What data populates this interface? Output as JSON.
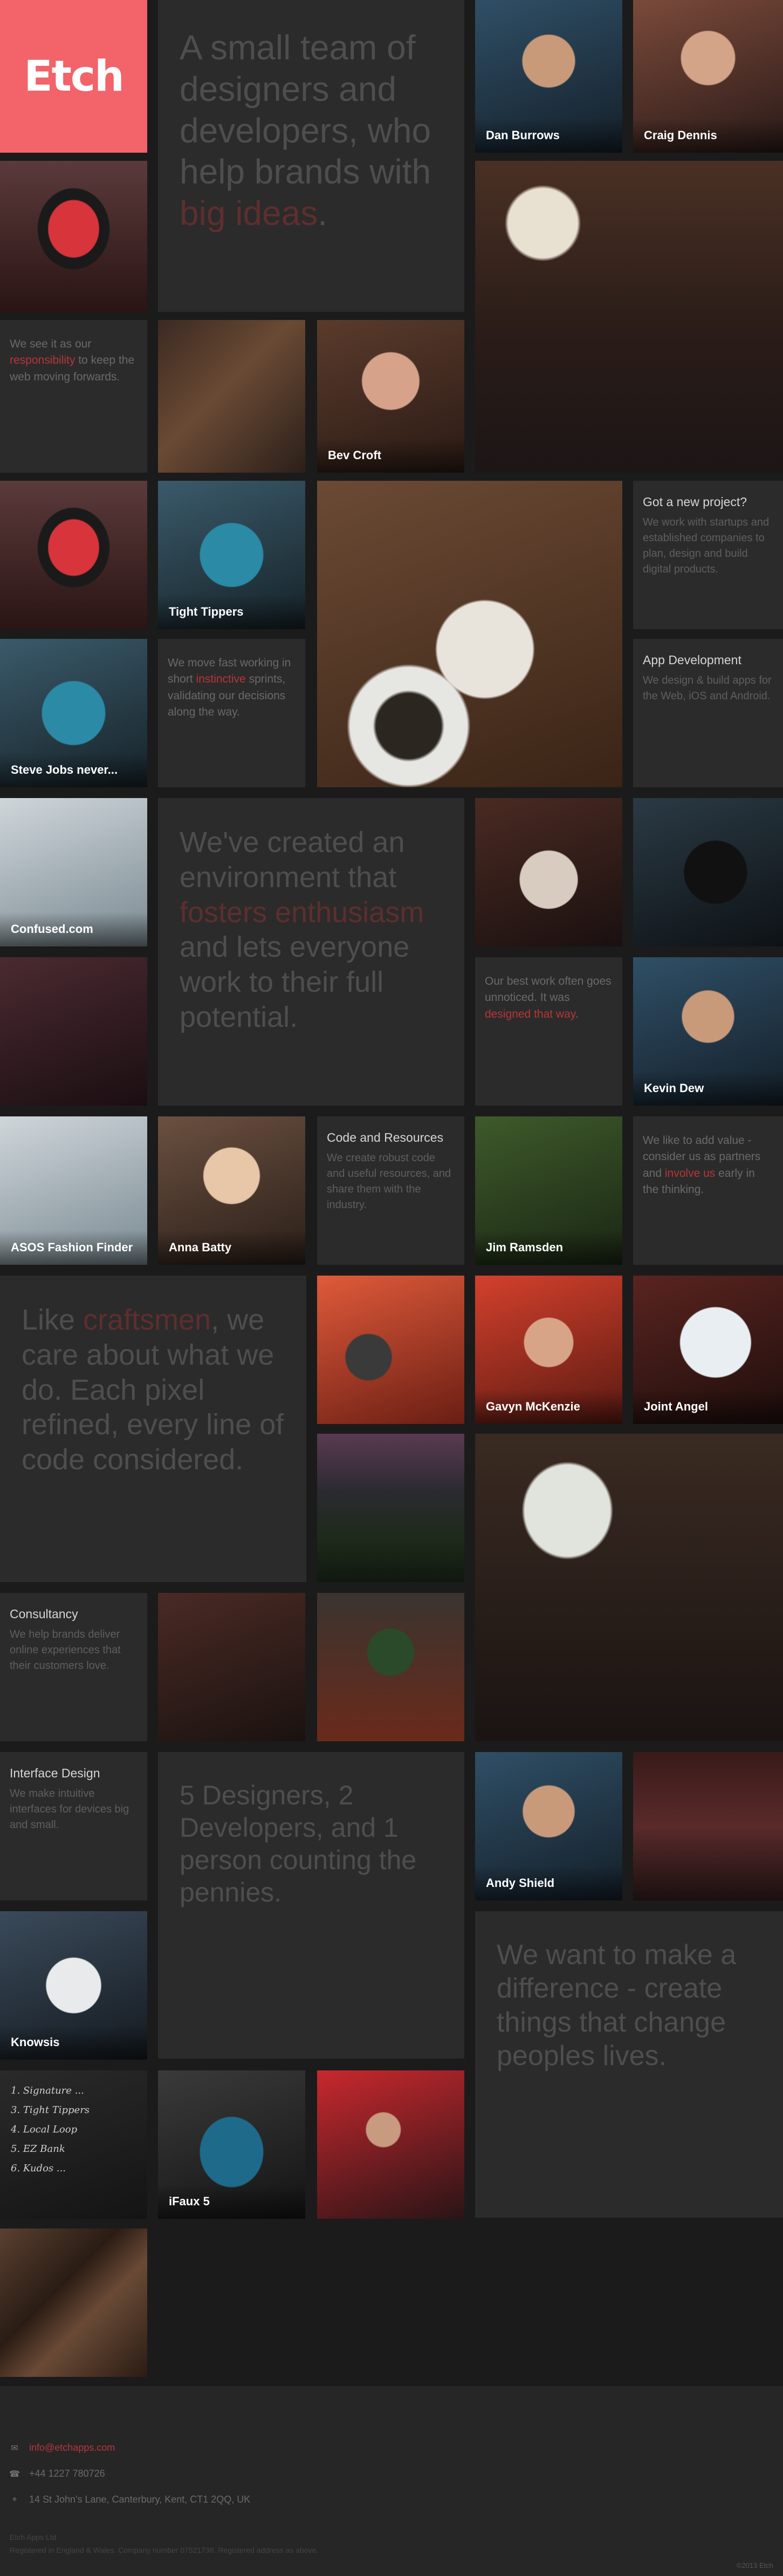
{
  "brand": {
    "logo_text": "Etch",
    "accent": "#f2636a",
    "highlight": "#b8353a"
  },
  "hero1": {
    "pre": "A small team of designers and developers, who help brands with ",
    "hl": "big ideas",
    "post": "."
  },
  "team": {
    "dan": "Dan Burrows",
    "craig": "Craig Dennis",
    "bev": "Bev Croft",
    "kevin": "Kevin Dew",
    "anna": "Anna Batty",
    "jim": "Jim Ramsden",
    "gavyn": "Gavyn McKenzie",
    "andy": "Andy Shield"
  },
  "responsibility": {
    "pre": "We see it as our ",
    "hl": "responsibility",
    "post": " to keep the web moving forwards."
  },
  "projects": {
    "tight_tippers": "Tight Tippers",
    "steve_jobs": "Steve Jobs never...",
    "confused": "Confused.com",
    "asos": "ASOS Fashion Finder",
    "joint_angel": "Joint Angel",
    "knowsis": "Knowsis",
    "ifaux": "iFaux 5"
  },
  "sprints": {
    "pre": "We move fast working in short ",
    "hl": "instinctive",
    "post": " sprints, validating our decisions along the way."
  },
  "services": {
    "new_project": {
      "title": "Got a new project?",
      "body": "We work with startups and established companies to plan, design and build digital products."
    },
    "app_dev": {
      "title": "App Development",
      "body": "We design & build apps for the Web, iOS and Android."
    },
    "code": {
      "title": "Code and Resources",
      "body": "We create robust code and useful resources, and share them with the industry."
    },
    "consultancy": {
      "title": "Consultancy",
      "body": "We help brands deliver online experiences that their customers love."
    },
    "interface": {
      "title": "Interface Design",
      "body": "We make intuitive interfaces for devices big and small."
    }
  },
  "hero2": {
    "pre": "We've created an environment that ",
    "hl": "fosters enthusiasm",
    "post": " and lets everyone work to their full potential."
  },
  "best_work": {
    "pre": "Our best work often goes unnoticed. It was ",
    "hl": "designed that way",
    "post": "."
  },
  "partners": {
    "pre": "We like to add value - consider us as partners and ",
    "hl": "involve us",
    "post": " early in the thinking."
  },
  "hero3": {
    "pre": "Like ",
    "hl": "craftsmen",
    "post": ", we care about what we do. Each pixel refined, every line of code considered."
  },
  "hero4": {
    "text": "5 Designers, 2 Developers, and 1 person counting the pennies."
  },
  "hero5": {
    "text": "We want to make a difference - create things that change peoples lives."
  },
  "chalkboard": {
    "lines": [
      "1. Signature ...",
      "3. Tight Tippers",
      "4. Local Loop",
      "5. EZ Bank",
      "6. Kudos ..."
    ]
  },
  "footer": {
    "email": "info@etchapps.com",
    "phone": "+44 1227 780726",
    "address": "14 St John's Lane, Canterbury, Kent, CT1 2QQ, UK",
    "company": "Etch Apps Ltd",
    "legal": "Registered in England & Wales. Company number 07521738. Registered address as above.",
    "credit": "©2013 Etch"
  }
}
